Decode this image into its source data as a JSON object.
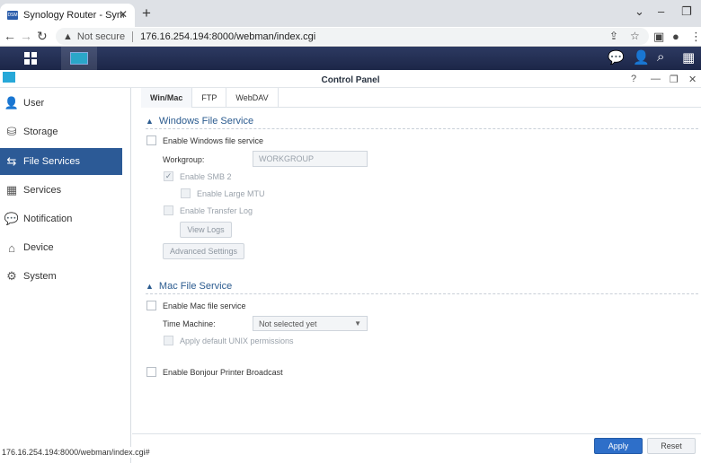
{
  "browser": {
    "tab_title": "Synology Router - SynologyRout",
    "favicon_text": "DSM",
    "address": {
      "security_label": "Not secure",
      "url": "176.16.254.194:8000/webman/index.cgi"
    },
    "status_url": "176.16.254.194:8000/webman/index.cgi#"
  },
  "window": {
    "title": "Control Panel"
  },
  "sidebar": {
    "items": [
      {
        "label": "User",
        "icon": "user-icon"
      },
      {
        "label": "Storage",
        "icon": "storage-icon"
      },
      {
        "label": "File Services",
        "icon": "file-services-icon",
        "active": true
      },
      {
        "label": "Services",
        "icon": "services-icon"
      },
      {
        "label": "Notification",
        "icon": "notification-icon"
      },
      {
        "label": "Device",
        "icon": "device-icon"
      },
      {
        "label": "System",
        "icon": "system-icon"
      }
    ]
  },
  "tabs": [
    "Win/Mac",
    "FTP",
    "WebDAV"
  ],
  "windows": {
    "title": "Windows File Service",
    "enable_label": "Enable Windows file service",
    "workgroup_label": "Workgroup:",
    "workgroup_value": "WORKGROUP",
    "smb2_label": "Enable SMB 2",
    "mtu_label": "Enable Large MTU",
    "transfer_log_label": "Enable Transfer Log",
    "view_logs": "View Logs",
    "advanced": "Advanced Settings"
  },
  "mac": {
    "title": "Mac File Service",
    "enable_label": "Enable Mac file service",
    "time_machine_label": "Time Machine:",
    "time_machine_value": "Not selected yet",
    "unix_label": "Apply default UNIX permissions"
  },
  "bonjour_label": "Enable Bonjour Printer Broadcast",
  "footer": {
    "apply": "Apply",
    "reset": "Reset"
  },
  "colors": {
    "accent": "#2c5a96",
    "apply": "#2e6fc9",
    "taskbar": "#1c2648"
  }
}
